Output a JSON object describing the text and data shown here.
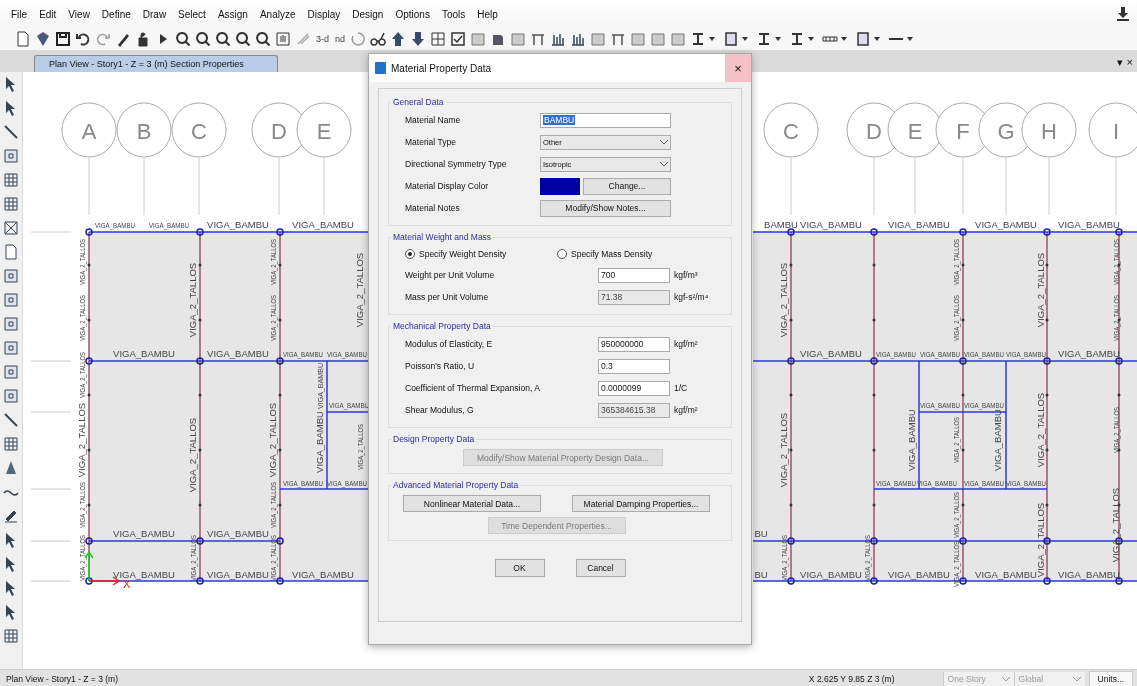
{
  "menu": [
    "File",
    "Edit",
    "View",
    "Define",
    "Draw",
    "Select",
    "Assign",
    "Analyze",
    "Display",
    "Design",
    "Options",
    "Tools",
    "Help"
  ],
  "toolbar": {
    "text_buttons": [
      "3-d",
      "nd"
    ]
  },
  "view_tab": {
    "title": "Plan View - Story1 - Z = 3 (m)  Section Properties",
    "selected": true
  },
  "tab_controls": [
    "▾",
    "×"
  ],
  "left_plan": {
    "bubbles": [
      "A",
      "B",
      "C",
      "D",
      "E"
    ],
    "horizontal_labels": [
      "VIGA_BAMBU",
      "VIGA_BAMBU",
      "VIGA_BAMBU",
      "VIGA_BAMBU",
      "VIGA_BAMBU",
      "VIGA_BAMBU",
      "VIGA_BAMBU",
      "VIGA_BAMBU",
      "VIGA_BAMBU",
      "VIGA_BAMBU",
      "VIGA_BAMBU",
      "VIGA_BAMBU",
      "VIGA_BAMBU",
      "VIGA_BAMBU",
      "VIGA_BAMBU",
      "VIGA_BAMBU"
    ],
    "vertical_labels": [
      "VIGA_2_TALLOS",
      "VIGA_2_TALLOS",
      "VIGA_2_TALLOS",
      "VIGA_2_TALLOS",
      "VIGA_2_TALLOS",
      "VIGA_2_TALLOS",
      "VIGA_2_TALLOS",
      "VIGA_2_TALLOS",
      "VIGA_2_TALLOS",
      "VIGA_2_TALLOS",
      "VIGA_2_TALLOS",
      "VIGA_2_TALLOS",
      "VIGA_2_TALLOS",
      "VIGA_2_TALLOS",
      "VIGA_BAMBU",
      "VIGA_BAMBU",
      "VIGA_2_TALLOS",
      "VIGA_2_TALLOS"
    ],
    "axis_label": "X"
  },
  "right_plan": {
    "bubbles": [
      "C",
      "D",
      "E",
      "F",
      "G",
      "H",
      "I"
    ],
    "horizontal_labels": [
      "BAMBU",
      "VIGA_BAMBU",
      "VIGA_BAMBU",
      "VIGA_BAMBU",
      "VIGA_BAMBU",
      "VIGA_BAMBU",
      "VIGA_BAMBU",
      "VIGA_BAMBU",
      "VIGA_BAMBU",
      "VIGA_BAMBU",
      "VIGA_BAMBU",
      "VIGA_BAMBU",
      "VIGA_BAMBU",
      "VIGA_BAMBU",
      "VIGA_BAMBU",
      "VIGA_BAMBU",
      "VIGA_BAMBU",
      "BU",
      "BU",
      "VIGA_BAMBU",
      "VIGA_BAMBU",
      "VIGA_BAMBU",
      "VIGA_BAMBU"
    ],
    "vertical_labels": [
      "VIGA_2_TALLOS",
      "VIGA_2_TALLOS",
      "VIGA_2_TALLOS",
      "VIGA_2_TALLOS",
      "VIGA_2_TALLOS",
      "VIGA_2_TALLOS",
      "VIGA_2_TALLOS",
      "VIGA_2_TALLOS",
      "VIGA_2_TALLOS",
      "VIGA_2_TALLOS",
      "VIGA_2_TALLOS",
      "VIGA_2_TALLOS",
      "VIGA_2_TALLOS",
      "VIGA_2_TALLOS",
      "VIGA_2_TALLOS",
      "VIGA_2_TALLOS",
      "VIGA_BAMBU",
      "VIGA_BAMBU"
    ]
  },
  "dialog": {
    "title": "Material Property Data",
    "close": "×",
    "general": {
      "legend": "General Data",
      "rows": [
        {
          "kind": "input",
          "label": "Material Name",
          "value": "BAMBU",
          "selected": true
        },
        {
          "kind": "select",
          "label": "Material Type",
          "value": "Other"
        },
        {
          "kind": "select",
          "label": "Directional Symmetry Type",
          "value": "Isotropic"
        },
        {
          "kind": "color",
          "label": "Material Display Color",
          "color": "#0000a0",
          "button": "Change..."
        },
        {
          "kind": "button",
          "label": "Material Notes",
          "button": "Modify/Show Notes..."
        }
      ]
    },
    "weight": {
      "legend": "Material Weight and Mass",
      "radios": [
        {
          "label": "Specify Weight Density",
          "selected": true
        },
        {
          "label": "Specify Mass Density",
          "selected": false
        }
      ],
      "rows": [
        {
          "label": "Weight per Unit Volume",
          "value": "700",
          "unit": "kgf/m³",
          "disabled": false
        },
        {
          "label": "Mass per Unit Volume",
          "value": "71.38",
          "unit": "kgf-s²/m⁴",
          "disabled": true
        }
      ]
    },
    "mechanical": {
      "legend": "Mechanical Property Data",
      "rows": [
        {
          "label": "Modulus of Elasticity,  E",
          "value": "950000000",
          "unit": "kgf/m²",
          "disabled": false
        },
        {
          "label": "Poisson's Ratio,  U",
          "value": "0.3",
          "disabled": false
        },
        {
          "label": "Coefficient of Thermal Expansion,  A",
          "value": "0.0000099",
          "unit": "1/C",
          "disabled": false
        },
        {
          "label": "Shear Modulus,  G",
          "value": "365384615.38",
          "unit": "kgf/m²",
          "disabled": true
        }
      ]
    },
    "design": {
      "legend": "Design Property Data",
      "button": {
        "label": "Modify/Show Material Property Design Data...",
        "disabled": true
      }
    },
    "advanced": {
      "legend": "Advanced Material Property Data",
      "buttons": [
        {
          "label": "Nonlinear Material Data...",
          "disabled": false
        },
        {
          "label": "Material Damping Properties...",
          "disabled": false
        },
        {
          "label": "Time Dependent Properties...",
          "disabled": true
        }
      ]
    },
    "actions": [
      "OK",
      "Cancel"
    ]
  },
  "status_bar": {
    "view": "Plan View - Story1 - Z = 3 (m)",
    "coordinates": "X 2.625  Y 9.85  Z 3 (m)",
    "story_select": "One Story",
    "coord_select": "Global",
    "units_button": "Units..."
  }
}
